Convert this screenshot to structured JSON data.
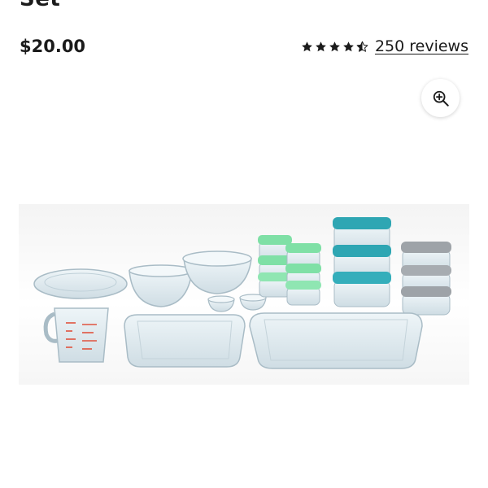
{
  "product": {
    "title_visible_fragment": "Set",
    "price": "$20.00",
    "rating": {
      "value": 4.5,
      "max": 5,
      "reviews_label": "250 reviews"
    }
  },
  "icons": {
    "zoom": "zoom-in-icon",
    "star": "star-icon"
  },
  "colors": {
    "text": "#1b1b1b",
    "lid_green": "#7fe0a6",
    "lid_teal": "#2ea6b3",
    "lid_gray": "#9ea3a8"
  }
}
